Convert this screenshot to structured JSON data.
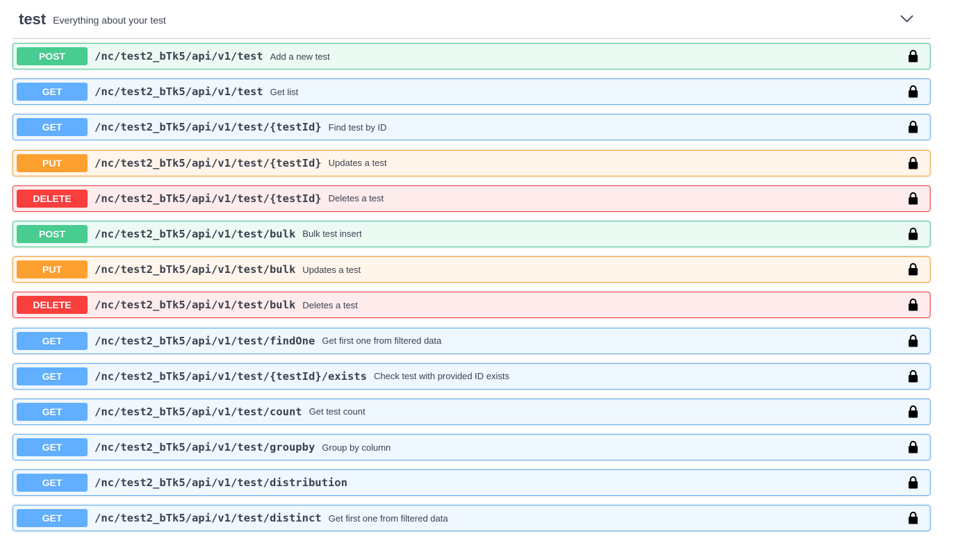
{
  "tag": {
    "name": "test",
    "description": "Everything about your test"
  },
  "colors": {
    "post": "#49cc90",
    "get": "#61affe",
    "put": "#fca130",
    "delete": "#f93e3e",
    "text": "#3b4151"
  },
  "icons": {
    "collapse": "chevron-up-icon",
    "lock": "lock-icon"
  },
  "operations": [
    {
      "method": "POST",
      "path": "/nc/test2_bTk5/api/v1/test",
      "summary": "Add a new test"
    },
    {
      "method": "GET",
      "path": "/nc/test2_bTk5/api/v1/test",
      "summary": "Get list"
    },
    {
      "method": "GET",
      "path": "/nc/test2_bTk5/api/v1/test/{testId}",
      "summary": "Find test by ID"
    },
    {
      "method": "PUT",
      "path": "/nc/test2_bTk5/api/v1/test/{testId}",
      "summary": "Updates a test"
    },
    {
      "method": "DELETE",
      "path": "/nc/test2_bTk5/api/v1/test/{testId}",
      "summary": "Deletes a test"
    },
    {
      "method": "POST",
      "path": "/nc/test2_bTk5/api/v1/test/bulk",
      "summary": "Bulk test insert"
    },
    {
      "method": "PUT",
      "path": "/nc/test2_bTk5/api/v1/test/bulk",
      "summary": "Updates a test"
    },
    {
      "method": "DELETE",
      "path": "/nc/test2_bTk5/api/v1/test/bulk",
      "summary": "Deletes a test"
    },
    {
      "method": "GET",
      "path": "/nc/test2_bTk5/api/v1/test/findOne",
      "summary": "Get first one from filtered data"
    },
    {
      "method": "GET",
      "path": "/nc/test2_bTk5/api/v1/test/{testId}/exists",
      "summary": "Check test with provided ID exists"
    },
    {
      "method": "GET",
      "path": "/nc/test2_bTk5/api/v1/test/count",
      "summary": "Get test count"
    },
    {
      "method": "GET",
      "path": "/nc/test2_bTk5/api/v1/test/groupby",
      "summary": "Group by column"
    },
    {
      "method": "GET",
      "path": "/nc/test2_bTk5/api/v1/test/distribution",
      "summary": ""
    },
    {
      "method": "GET",
      "path": "/nc/test2_bTk5/api/v1/test/distinct",
      "summary": "Get first one from filtered data"
    }
  ]
}
